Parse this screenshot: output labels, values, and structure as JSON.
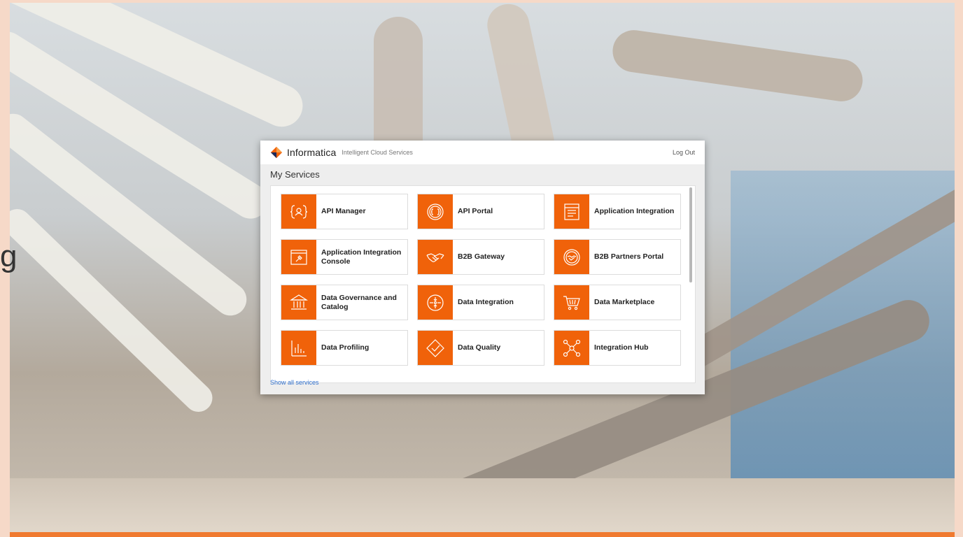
{
  "side_glyph": "g",
  "header": {
    "brand": "Informatica",
    "subtitle": "Intelligent Cloud Services",
    "logout": "Log Out"
  },
  "section_title": "My Services",
  "services": [
    {
      "label": "API Manager",
      "icon": "api-manager-icon"
    },
    {
      "label": "API Portal",
      "icon": "api-portal-icon"
    },
    {
      "label": "Application Integration",
      "icon": "application-integration-icon"
    },
    {
      "label": "Application Integration Console",
      "icon": "application-integration-console-icon"
    },
    {
      "label": "B2B Gateway",
      "icon": "b2b-gateway-icon"
    },
    {
      "label": "B2B Partners Portal",
      "icon": "b2b-partners-portal-icon"
    },
    {
      "label": "Data Governance and Catalog",
      "icon": "data-governance-icon"
    },
    {
      "label": "Data Integration",
      "icon": "data-integration-icon"
    },
    {
      "label": "Data Marketplace",
      "icon": "data-marketplace-icon"
    },
    {
      "label": "Data Profiling",
      "icon": "data-profiling-icon"
    },
    {
      "label": "Data Quality",
      "icon": "data-quality-icon"
    },
    {
      "label": "Integration Hub",
      "icon": "integration-hub-icon"
    }
  ],
  "show_all": "Show all services",
  "colors": {
    "accent": "#f0620a",
    "link": "#2f6fcc",
    "bottom_bar": "#f07a30"
  }
}
